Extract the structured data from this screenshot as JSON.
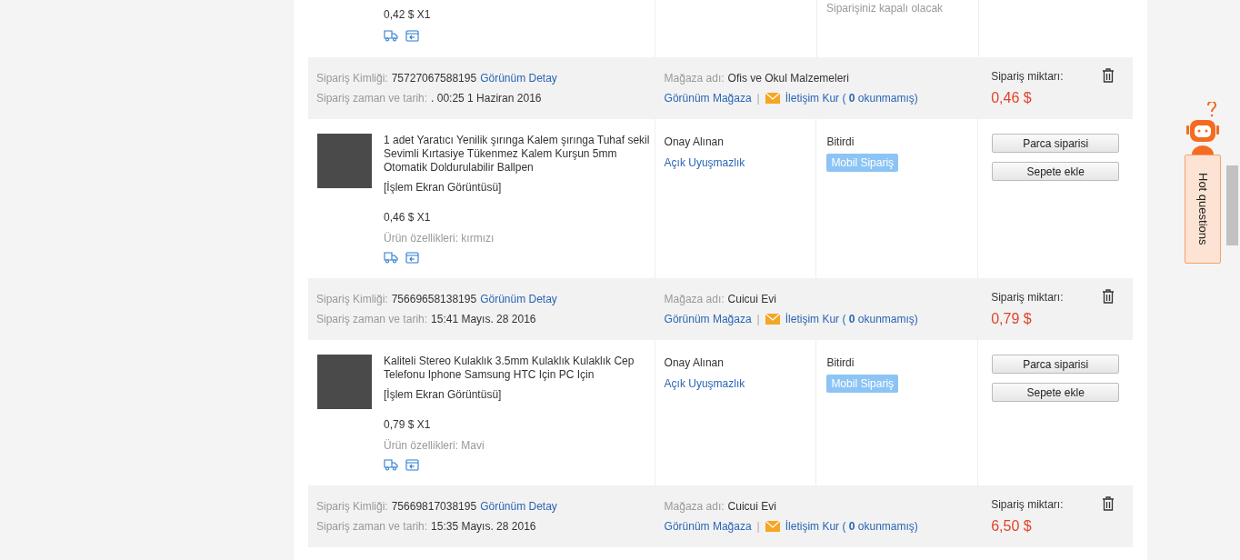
{
  "previous_order_tail": {
    "unit_price": "0,42 $ X1",
    "status_note": "Siparişiniz kapalı olacak"
  },
  "orders": [
    {
      "id_label": "Sipariş Kimliği:",
      "id": "75727067588195",
      "detail_link": "Görünüm Detay",
      "time_label": "Sipariş zaman ve tarih:",
      "time": ". 00:25 1 Haziran 2016",
      "store_label": "Mağaza adı:",
      "store": "Ofis ve Okul Malzemeleri",
      "store_link": "Görünüm Mağaza",
      "separator": "|",
      "contact_link": "İletişim Kur (",
      "unread_count": "0",
      "unread_label": "okunmamış)",
      "amount_label": "Sipariş miktarı:",
      "amount": "0,46 $",
      "product": {
        "title": "1 adet Yaratıcı Yenilik şırınga Kalem şırınga Tuhaf sekil Sevimli Kırtasiye Tükenmez Kalem Kurşun 5mm Otomatik Doldurulabilir Ballpen",
        "screenshot_link": "[İşlem Ekran Görüntüsü]",
        "unit_price": "0,46 $ X1",
        "properties": "Ürün özellikleri: kırmızı",
        "confirm_status": "Onay Alınan",
        "dispute_link": "Açık Uyuşmazlık",
        "order_status": "Bitirdi",
        "badge": "Mobil Sipariş",
        "buttons": [
          "Parca siparisi",
          "Sepete ekle"
        ]
      }
    },
    {
      "id_label": "Sipariş Kimliği:",
      "id": "75669658138195",
      "detail_link": "Görünüm Detay",
      "time_label": "Sipariş zaman ve tarih:",
      "time": "15:41 Mayıs. 28 2016",
      "store_label": "Mağaza adı:",
      "store": "Cuicui Evi",
      "store_link": "Görünüm Mağaza",
      "separator": "|",
      "contact_link": "İletişim Kur (",
      "unread_count": "0",
      "unread_label": "okunmamış)",
      "amount_label": "Sipariş miktarı:",
      "amount": "0,79 $",
      "product": {
        "title": "Kaliteli Stereo Kulaklık 3.5mm Kulaklık Kulaklık Cep Telefonu Iphone Samsung HTC Için PC Için",
        "screenshot_link": "[İşlem Ekran Görüntüsü]",
        "unit_price": "0,79 $ X1",
        "properties": "Ürün özellikleri: Mavi",
        "confirm_status": "Onay Alınan",
        "dispute_link": "Açık Uyuşmazlık",
        "order_status": "Bitirdi",
        "badge": "Mobil Sipariş",
        "buttons": [
          "Parca siparisi",
          "Sepete ekle"
        ]
      }
    },
    {
      "id_label": "Sipariş Kimliği:",
      "id": "75669817038195",
      "detail_link": "Görünüm Detay",
      "time_label": "Sipariş zaman ve tarih:",
      "time": "15:35 Mayıs. 28 2016",
      "store_label": "Mağaza adı:",
      "store": "Cuicui Evi",
      "store_link": "Görünüm Mağaza",
      "separator": "|",
      "contact_link": "İletişim Kur (",
      "unread_count": "0",
      "unread_label": "okunmamış)",
      "amount_label": "Sipariş miktarı:",
      "amount": "6,50 $"
    }
  ],
  "help_widget": {
    "label": "Hot questions"
  }
}
